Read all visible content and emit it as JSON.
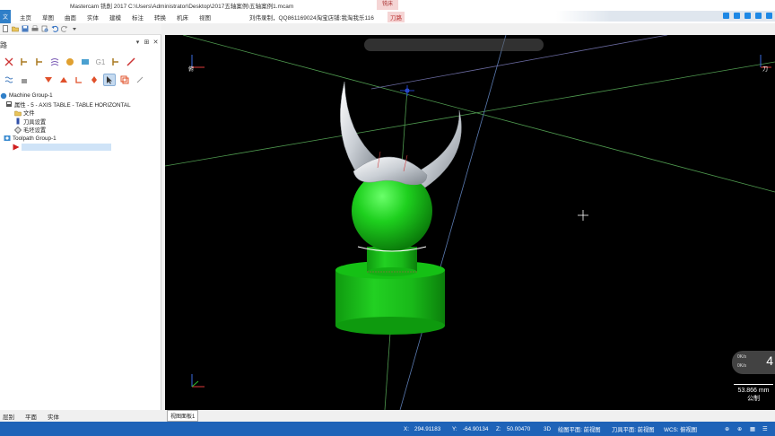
{
  "titlebar": {
    "title": "Mastercam 铣削 2017  C:\\Users\\Administrator\\Desktop\\2017五轴案例\\五轴案例1.mcam",
    "mode_tab": "铣床"
  },
  "ribbon": {
    "file_label": "文",
    "tabs": [
      "主页",
      "草图",
      "曲面",
      "实体",
      "建模",
      "标注",
      "转换",
      "机床",
      "视图"
    ],
    "notice": "刘伟录制，QQ861169024淘宝店铺:我淘我乐116",
    "highlight_tab": "刀路"
  },
  "left_panel": {
    "title": "路",
    "tree": [
      {
        "label": "Machine Group-1",
        "level": 0,
        "icon": "machine-group-icon"
      },
      {
        "label": "属性 - 5 - AXIS TABLE - TABLE HORIZONTAL",
        "level": 1,
        "icon": "properties-icon"
      },
      {
        "label": "文件",
        "level": 2,
        "icon": "folder-icon"
      },
      {
        "label": "刀具设置",
        "level": 2,
        "icon": "tool-settings-icon"
      },
      {
        "label": "毛坯设置",
        "level": 2,
        "icon": "stock-settings-icon"
      },
      {
        "label": "Toolpath Group-1",
        "level": 1,
        "icon": "toolpath-group-icon"
      },
      {
        "label": "",
        "level": 1,
        "icon": "insert-arrow-icon",
        "selected": true
      }
    ]
  },
  "viewport": {
    "view_label_top": "俯",
    "view_label_right": "刀",
    "scale_value": "53.866 mm",
    "scale_unit": "公制",
    "gizmo_number": "4",
    "gizmo_rows": [
      "0K/s",
      "0K/s"
    ]
  },
  "bottom_left_tabs": [
    "层别",
    "平面",
    "实体"
  ],
  "bottom_right_tabs": [
    "视图面板1"
  ],
  "statusbar": {
    "x_label": "X:",
    "x_value": "294.91183",
    "y_label": "Y:",
    "y_value": "-64.90134",
    "z_label": "Z:",
    "z_value": "50.00470",
    "mode": "3D",
    "drawing_plane": "绘图平面: 前视图",
    "tool_plane": "刀具平面: 前视图",
    "wcs": "WCS: 俯视图"
  },
  "colors": {
    "statusbar": "#1e63b8",
    "viewport_bg": "#000000",
    "model_green": "#16b416",
    "grid_green": "#4f9a4f"
  }
}
